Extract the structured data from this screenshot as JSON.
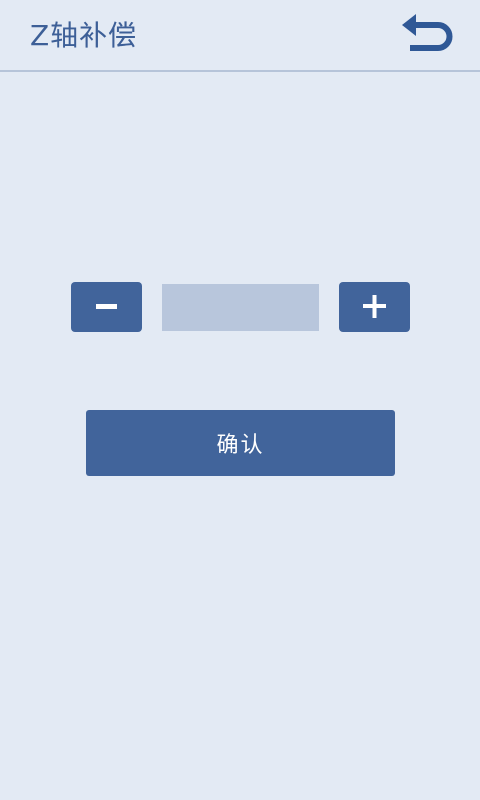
{
  "header": {
    "title": "Z轴补偿",
    "back_icon": "undo-arrow-icon"
  },
  "stepper": {
    "decrement_icon": "minus-icon",
    "increment_icon": "plus-icon",
    "value": "",
    "placeholder": ""
  },
  "actions": {
    "confirm_label": "确认"
  },
  "colors": {
    "background": "#e3eaf4",
    "accent": "#41649b",
    "title": "#3d5f97",
    "field": "#b8c6dc",
    "back_icon": "#2f5896"
  }
}
